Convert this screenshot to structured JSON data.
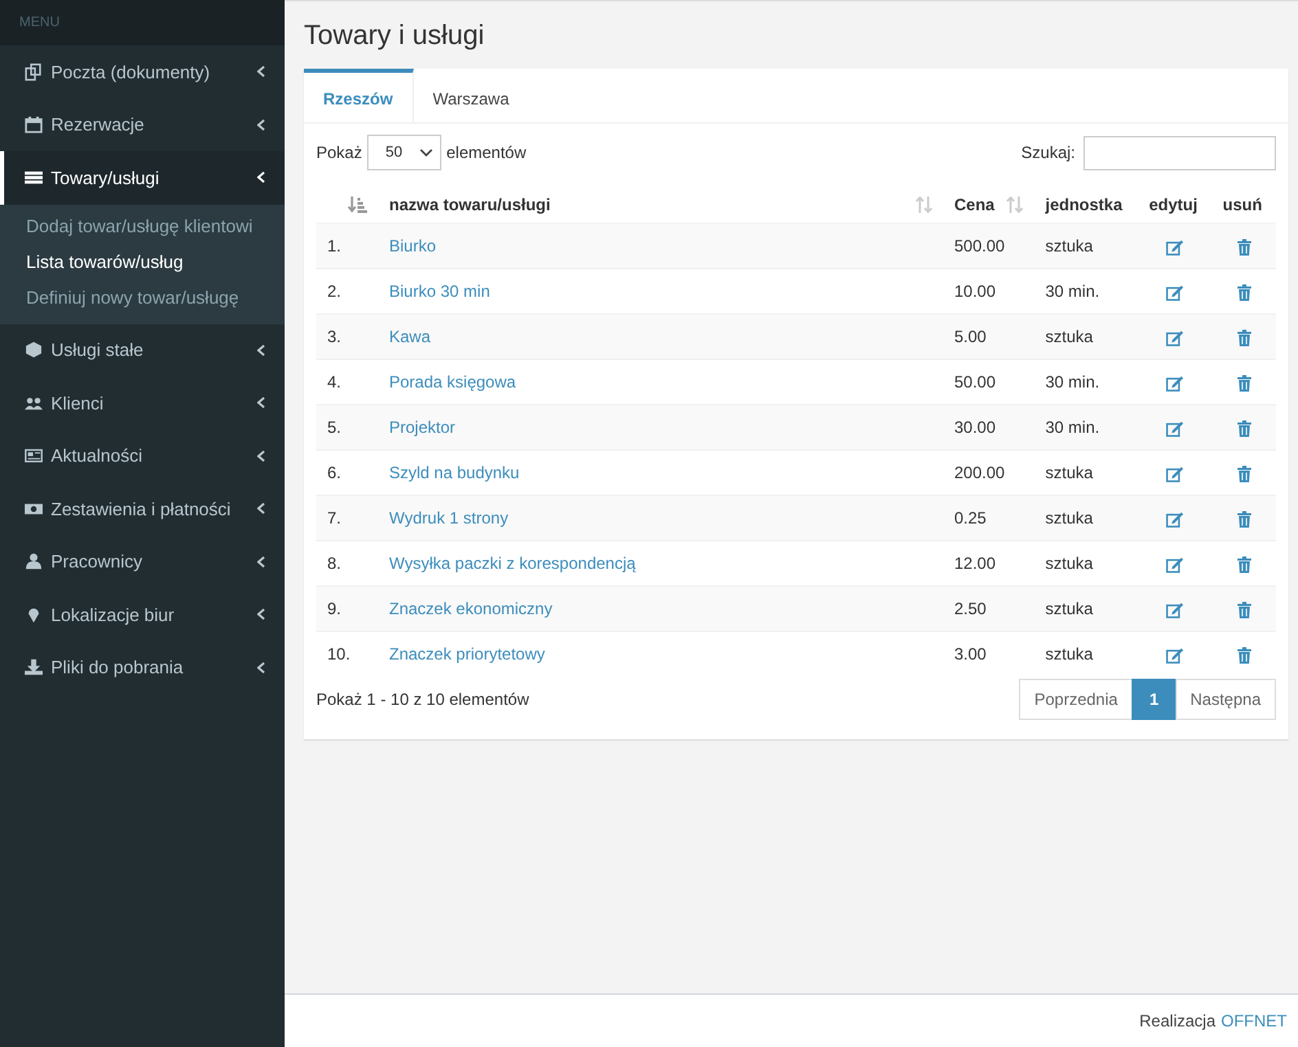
{
  "sidebar": {
    "header": "MENU",
    "items": [
      {
        "label": "Poczta (dokumenty)",
        "selected": false,
        "expanded": false
      },
      {
        "label": "Rezerwacje",
        "selected": false,
        "expanded": false
      },
      {
        "label": "Towary/usługi",
        "selected": true,
        "expanded": true,
        "children": [
          {
            "label": "Dodaj towar/usługę klientowi",
            "selected": false
          },
          {
            "label": "Lista towarów/usług",
            "selected": true
          },
          {
            "label": "Definiuj nowy towar/usługę",
            "selected": false
          }
        ]
      },
      {
        "label": "Usługi stałe",
        "selected": false,
        "expanded": false
      },
      {
        "label": "Klienci",
        "selected": false,
        "expanded": false
      },
      {
        "label": "Aktualności",
        "selected": false,
        "expanded": false
      },
      {
        "label": "Zestawienia i płatności",
        "selected": false,
        "expanded": false
      },
      {
        "label": "Pracownicy",
        "selected": false,
        "expanded": false
      },
      {
        "label": "Lokalizacje biur",
        "selected": false,
        "expanded": false
      },
      {
        "label": "Pliki do pobrania",
        "selected": false,
        "expanded": false
      }
    ]
  },
  "page_title": "Towary i usługi",
  "tabs": [
    {
      "label": "Rzeszów",
      "selected": true
    },
    {
      "label": "Warszawa",
      "selected": false
    }
  ],
  "length": {
    "prefix": "Pokaż",
    "value": "50",
    "suffix": "elementów"
  },
  "search": {
    "label": "Szukaj:"
  },
  "table": {
    "columns": [
      {
        "sorted": true
      },
      {
        "label": "nazwa towaru/usługi",
        "sorted": false
      },
      {
        "label": "Cena",
        "sorted": false
      },
      {
        "label": "jednostka"
      },
      {
        "label": "edytuj"
      },
      {
        "label": "usuń"
      }
    ],
    "rows": [
      {
        "no": "1.",
        "name": "Biurko",
        "price": "500.00",
        "unit": "sztuka"
      },
      {
        "no": "2.",
        "name": "Biurko 30 min",
        "price": "10.00",
        "unit": "30 min."
      },
      {
        "no": "3.",
        "name": "Kawa",
        "price": "5.00",
        "unit": "sztuka"
      },
      {
        "no": "4.",
        "name": "Porada księgowa",
        "price": "50.00",
        "unit": "30 min."
      },
      {
        "no": "5.",
        "name": "Projektor",
        "price": "30.00",
        "unit": "30 min."
      },
      {
        "no": "6.",
        "name": "Szyld na budynku",
        "price": "200.00",
        "unit": "sztuka"
      },
      {
        "no": "7.",
        "name": "Wydruk 1 strony",
        "price": "0.25",
        "unit": "sztuka"
      },
      {
        "no": "8.",
        "name": "Wysyłka paczki z korespondencją",
        "price": "12.00",
        "unit": "sztuka"
      },
      {
        "no": "9.",
        "name": "Znaczek ekonomiczny",
        "price": "2.50",
        "unit": "sztuka"
      },
      {
        "no": "10.",
        "name": "Znaczek priorytetowy",
        "price": "3.00",
        "unit": "sztuka"
      }
    ]
  },
  "info": "Pokaż 1 - 10 z 10 elementów",
  "pagination": [
    {
      "label": "Poprzednia",
      "selected": false
    },
    {
      "label": "1",
      "selected": true
    },
    {
      "label": "Następna",
      "selected": false
    }
  ],
  "footer": {
    "text": "Realizacja",
    "link": "OFFNET"
  }
}
